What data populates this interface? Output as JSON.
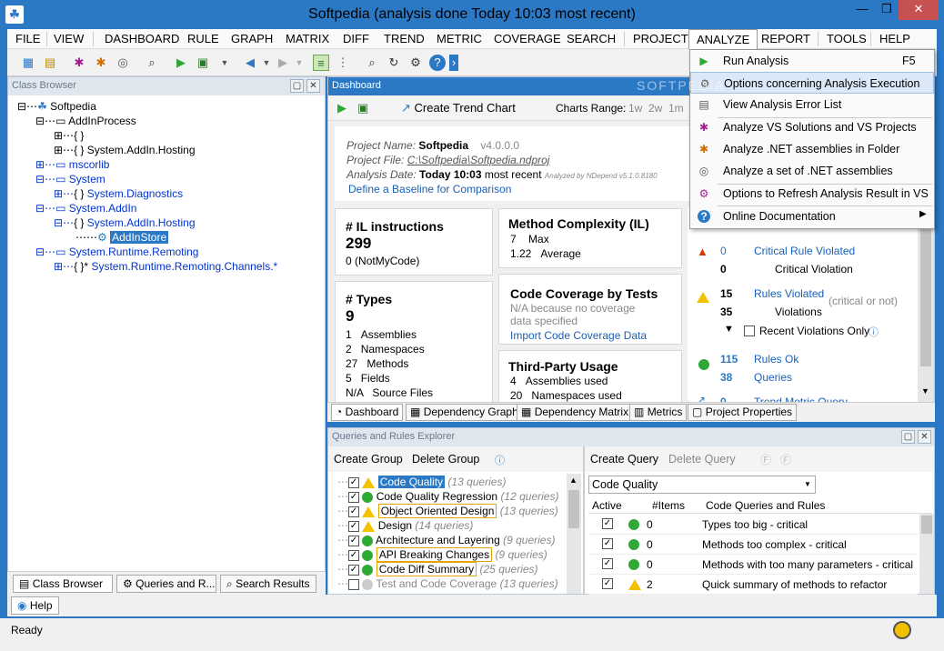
{
  "window": {
    "title": "Softpedia  (analysis done Today 10:03 most recent)",
    "minimize": "—",
    "maximize": "❐",
    "close": "✕"
  },
  "menu": [
    "FILE",
    "VIEW",
    "DASHBOARD",
    "RULE",
    "GRAPH",
    "MATRIX",
    "DIFF",
    "TREND",
    "METRIC",
    "COVERAGE",
    "SEARCH",
    "PROJECT",
    "ANALYZE",
    "REPORT",
    "TOOLS",
    "HELP"
  ],
  "class_browser": {
    "title": "Class Browser",
    "tree": [
      {
        "label": "Softpedia",
        "style": "normal"
      },
      {
        "label": "AddInProcess",
        "style": "normal"
      },
      {
        "label": "{ }",
        "style": "normal"
      },
      {
        "label": "System.AddIn.Hosting",
        "style": "normal"
      },
      {
        "label": "mscorlib",
        "style": "blue"
      },
      {
        "label": "System",
        "style": "blue"
      },
      {
        "label": "System.Diagnostics",
        "style": "blue"
      },
      {
        "label": "System.AddIn",
        "style": "blue"
      },
      {
        "label": "System.AddIn.Hosting",
        "style": "blue"
      },
      {
        "label": "AddInStore",
        "style": "selected"
      },
      {
        "label": "System.Runtime.Remoting",
        "style": "blue"
      },
      {
        "label": "System.Runtime.Remoting.Channels.*",
        "style": "blue"
      }
    ],
    "tabs": [
      "Class Browser",
      "Queries and R...",
      "Search Results"
    ]
  },
  "dashboard": {
    "title": "Dashboard",
    "create_trend": "Create Trend Chart",
    "charts_range": "Charts Range:",
    "ranges": [
      "1w",
      "2w",
      "1m"
    ],
    "project": {
      "name_label": "Project Name:",
      "name": "Softpedia",
      "version": "v4.0.0.0",
      "file_label": "Project File:",
      "file": "C:\\Softpedia\\Softpedia.ndproj",
      "date_label": "Analysis Date:",
      "date": "Today 10:03",
      "date_suffix": "most recent",
      "analyzed_by": "Analyzed by NDepend v5.1.0.8180",
      "baseline_link": "Define a Baseline for Comparison"
    },
    "il": {
      "title": "# IL instructions",
      "value": "299",
      "sub_value": "0",
      "sub_label": "(NotMyCode)"
    },
    "complexity": {
      "title": "Method Complexity (IL)",
      "max_value": "7",
      "max_label": "Max",
      "avg_value": "1.22",
      "avg_label": "Average"
    },
    "types": {
      "title": "# Types",
      "value": "9",
      "rows": [
        [
          "1",
          "Assemblies"
        ],
        [
          "2",
          "Namespaces"
        ],
        [
          "27",
          "Methods"
        ],
        [
          "5",
          "Fields"
        ],
        [
          "N/A",
          "Source Files"
        ]
      ]
    },
    "coverage": {
      "title": "Code Coverage by Tests",
      "note1": "N/A because no coverage",
      "note2": "data specified",
      "link": "Import Code Coverage Data"
    },
    "thirdparty": {
      "title": "Third-Party Usage",
      "rows": [
        [
          "4",
          "Assemblies used"
        ],
        [
          "20",
          "Namespaces used"
        ]
      ]
    },
    "rules": {
      "critical_count": "0",
      "critical_label": "Critical Rule Violated",
      "critical_viol_count": "0",
      "critical_viol_label": "Critical Violation",
      "violated_count": "15",
      "violated_label": "Rules Violated",
      "violated_note": "(critical or not)",
      "violations_count": "35",
      "violations_label": "Violations",
      "recent_label": "Recent Violations Only",
      "ok_count": "115",
      "ok_label": "Rules Ok",
      "queries_count": "38",
      "queries_label": "Queries",
      "trend_count": "0",
      "trend_label": "Trend Metric Query"
    },
    "tabs": [
      "Dashboard",
      "Dependency Graph",
      "Dependency Matrix",
      "Metrics",
      "Project Properties"
    ]
  },
  "queries_explorer": {
    "title": "Queries and Rules Explorer",
    "create_group": "Create Group",
    "delete_group": "Delete Group",
    "groups": [
      {
        "name": "Code Quality",
        "count": "(13 queries)",
        "icon": "warn",
        "style": "selected"
      },
      {
        "name": "Code Quality Regression",
        "count": "(12 queries)",
        "icon": "ok",
        "style": "plain"
      },
      {
        "name": "Object Oriented Design",
        "count": "(13 queries)",
        "icon": "warn",
        "style": "hl"
      },
      {
        "name": "Design",
        "count": "(14 queries)",
        "icon": "warn",
        "style": "plain"
      },
      {
        "name": "Architecture and Layering",
        "count": "(9 queries)",
        "icon": "ok",
        "style": "plain"
      },
      {
        "name": "API Breaking Changes",
        "count": "(9 queries)",
        "icon": "ok",
        "style": "hl"
      },
      {
        "name": "Code Diff Summary",
        "count": "(25 queries)",
        "icon": "ok",
        "style": "hl"
      },
      {
        "name": "Test and Code Coverage",
        "count": "(13 queries)",
        "icon": "grey",
        "style": "gray"
      }
    ],
    "create_query": "Create Query",
    "delete_query": "Delete Query",
    "group_select": "Code Quality",
    "columns": [
      "Active",
      "#Items",
      "Code Queries and Rules"
    ],
    "rows": [
      {
        "items": "0",
        "name": "Types too big - critical",
        "icon": "ok"
      },
      {
        "items": "0",
        "name": "Methods too complex - critical",
        "icon": "ok"
      },
      {
        "items": "0",
        "name": "Methods with too many parameters - critical",
        "icon": "ok"
      },
      {
        "items": "2",
        "name": "Quick summary of methods to refactor",
        "icon": "warn"
      }
    ]
  },
  "analyze_menu": [
    {
      "label": "Run Analysis",
      "shortcut": "F5",
      "icon": "play-icon"
    },
    {
      "label": "Options concerning Analysis Execution",
      "shortcut": "",
      "icon": "gear-icon"
    },
    {
      "label": "View Analysis Error List",
      "shortcut": "",
      "icon": "error-list-icon"
    },
    {
      "label": "Analyze VS Solutions and VS Projects",
      "shortcut": "",
      "icon": "vs-icon"
    },
    {
      "label": "Analyze .NET assemblies in Folder",
      "shortcut": "",
      "icon": "folder-icon"
    },
    {
      "label": "Analyze a set of .NET assemblies",
      "shortcut": "",
      "icon": "assemblies-icon"
    },
    {
      "label": "Options to Refresh Analysis Result in VS",
      "shortcut": "",
      "icon": "refresh-gear-icon"
    },
    {
      "label": "Online Documentation",
      "shortcut": "",
      "icon": "help-icon"
    }
  ],
  "watermark": "SOFTPEDIA",
  "help_button": "Help",
  "status": "Ready",
  "colors": {
    "accent": "#2b78c4",
    "ok": "#2fa836",
    "warn": "#f2c200",
    "link": "#1a5fb4"
  }
}
